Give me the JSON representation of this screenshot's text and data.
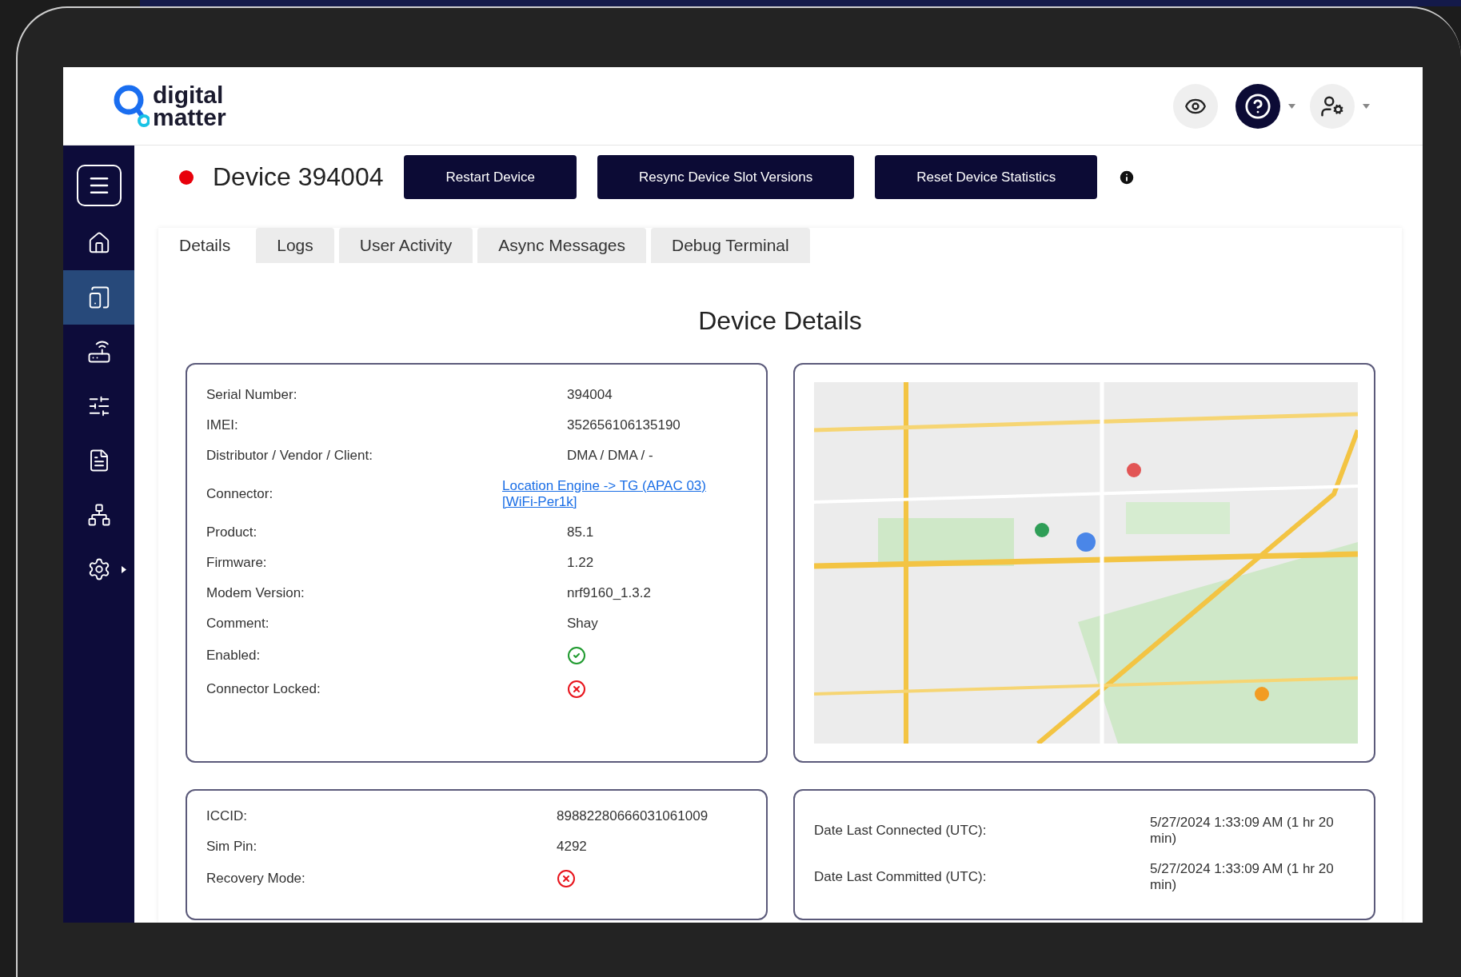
{
  "header": {
    "logo": {
      "line_1": "digital",
      "line_2": "matter"
    }
  },
  "sidebar": {
    "items": [
      {
        "selected": false
      },
      {
        "selected": false
      },
      {
        "selected": true
      },
      {
        "selected": false
      },
      {
        "selected": false
      },
      {
        "selected": false
      },
      {
        "selected": false
      },
      {
        "selected": false
      }
    ]
  },
  "device": {
    "title": "Device 394004",
    "status_dot": {
      "color": "#e8000b"
    }
  },
  "actions": [
    "Restart Device",
    "Resync Device Slot Versions",
    "Reset Device Statistics"
  ],
  "tabs": [
    {
      "label": "Details",
      "selected": true
    },
    {
      "label": "Logs",
      "selected": false
    },
    {
      "label": "User Activity",
      "selected": false
    },
    {
      "label": "Async Messages",
      "selected": false
    },
    {
      "label": "Debug Terminal",
      "selected": false
    }
  ],
  "section_title": "Device Details",
  "details": [
    {
      "kind": "text",
      "label": "Serial Number:",
      "value": "394004"
    },
    {
      "kind": "text",
      "label": "IMEI:",
      "value": "352656106135190"
    },
    {
      "kind": "text",
      "label": "Distributor / Vendor / Client:",
      "value": "DMA / DMA / -"
    },
    {
      "kind": "link",
      "label": "Connector:",
      "value": "Location Engine -> TG (APAC 03) [WiFi-Per1k]"
    },
    {
      "kind": "text",
      "label": "Product:",
      "value": "85.1"
    },
    {
      "kind": "text",
      "label": "Firmware:",
      "value": "1.22"
    },
    {
      "kind": "text",
      "label": "Modem Version:",
      "value": "nrf9160_1.3.2"
    },
    {
      "kind": "text",
      "label": "Comment:",
      "value": "Shay"
    },
    {
      "kind": "flag",
      "label": "Enabled:",
      "checked": true
    },
    {
      "kind": "flag",
      "label": "Connector Locked:",
      "checked": false
    }
  ],
  "sim": [
    {
      "kind": "text",
      "label": "ICCID:",
      "value": "89882280666031061009"
    },
    {
      "kind": "text",
      "label": "Sim Pin:",
      "value": "4292"
    },
    {
      "kind": "flag",
      "label": "Recovery Mode:",
      "checked": false
    }
  ],
  "connection": [
    {
      "label": "Date Last Connected (UTC):",
      "value": "5/27/2024 1:33:09 AM (1 hr 20 min)"
    },
    {
      "label": "Date Last Committed (UTC):",
      "value": "5/27/2024 1:33:09 AM (1 hr 20 min)"
    }
  ]
}
